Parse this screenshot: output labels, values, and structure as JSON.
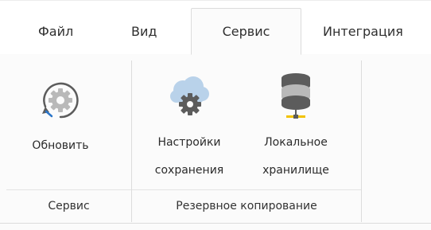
{
  "tabs": [
    {
      "label": "Файл"
    },
    {
      "label": "Вид"
    },
    {
      "label": "Сервис"
    },
    {
      "label": "Интеграция"
    }
  ],
  "active_tab": "Сервис",
  "groups": {
    "service": {
      "label": "Сервис",
      "buttons": {
        "refresh": {
          "label": "Обновить",
          "icon": "refresh-gear-icon"
        }
      }
    },
    "backup": {
      "label": "Резервное копирование",
      "buttons": {
        "settings": {
          "line1": "Настройки",
          "line2": "сохранения",
          "icon": "cloud-gear-icon"
        },
        "local": {
          "line1": "Локальное",
          "line2": "хранилище",
          "icon": "database-icon"
        }
      }
    }
  },
  "colors": {
    "icon_gray": "#5c5c5c",
    "icon_light_gray": "#b9b9b9",
    "cloud_blue": "#b9d2ea",
    "accent_yellow": "#f2c200",
    "refresh_blue": "#2c76c9"
  }
}
